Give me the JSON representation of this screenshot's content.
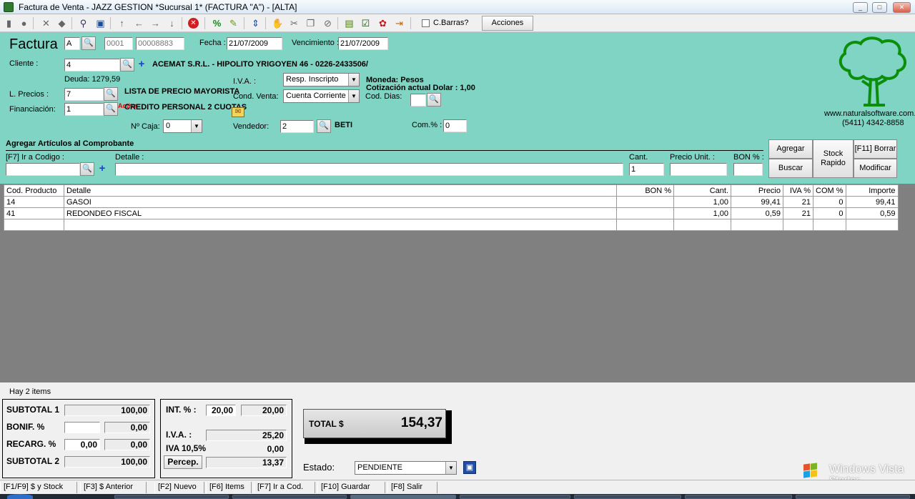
{
  "window": {
    "title": "Factura de Venta - JAZZ GESTION *Sucursal 1* (FACTURA \"A\") - [ALTA]",
    "minimize": "_",
    "maximize": "□",
    "close": "✕"
  },
  "toolbar": {
    "cbarras_label": "C.Barras?",
    "acciones_label": "Acciones"
  },
  "header": {
    "factura_label": "Factura",
    "tipo": "A",
    "punto_venta": "0001",
    "numero": "00008883",
    "fecha_label": "Fecha :",
    "fecha": "21/07/2009",
    "vencimiento_label": "Vencimiento :",
    "vencimiento": "21/07/2009"
  },
  "cliente": {
    "label": "Cliente :",
    "codigo": "4",
    "descripcion": "ACEMAT S.R.L. - HIPOLITO YRIGOYEN 46 - 0226-2433506/",
    "deuda": "Deuda: 1279,59",
    "iva_label": "I.V.A. :",
    "iva_value": "Resp. Inscripto",
    "moneda": "Moneda: Pesos",
    "cotizacion": "Cotización actual Dolar : 1,00",
    "lprecios_label": "L. Precios :",
    "lprecios_codigo": "7",
    "lprecios_desc": "LISTA DE PRECIO MAYORISTA",
    "cond_venta_label": "Cond. Venta:",
    "cond_venta_value": "Cuenta Corriente",
    "cod_dias_label": "Cod. Dias:",
    "cod_dias_value": "",
    "financiacion_label": "Financiación:",
    "financiacion_codigo": "1",
    "financiacion_desc": "CREDITO PERSONAL 2 CUOTAS",
    "red_overlay": "Activa",
    "nro_caja_label": "Nº Caja:",
    "nro_caja_value": "0",
    "vendedor_label": "Vendedor:",
    "vendedor_codigo": "2",
    "vendedor_nombre": "BETI",
    "com_label": "Com.% :",
    "com_value": "0"
  },
  "logo": {
    "website": "www.naturalsoftware.com.ar",
    "phone": "(5411) 4342-8858"
  },
  "agregar": {
    "section_title": "Agregar Artículos al Comprobante",
    "ir_codigo_label": "[F7] Ir a Codigo :",
    "ir_codigo_value": "",
    "detalle_label": "Detalle :",
    "detalle_value": "",
    "cant_label": "Cant.",
    "cant_value": "1",
    "precio_label": "Precio Unit. :",
    "precio_value": "",
    "bon_label": "BON % :",
    "bon_value": "",
    "btn_agregar": "Agregar",
    "btn_buscar": "Buscar",
    "btn_stock": "Stock Rapido",
    "btn_borrar": "[F11] Borrar",
    "btn_modificar": "Modificar"
  },
  "grid": {
    "columns": [
      "Cod. Producto",
      "Detalle",
      "BON %",
      "Cant.",
      "Precio",
      "IVA %",
      "COM %",
      "Importe"
    ],
    "rows": [
      [
        "14",
        "GASOI",
        "",
        "1,00",
        "99,41",
        "21",
        "0",
        "99,41"
      ],
      [
        "41",
        "REDONDEO FISCAL",
        "",
        "1,00",
        "0,59",
        "21",
        "0",
        "0,59"
      ],
      [
        "",
        "",
        "",
        "",
        "",
        "",
        "",
        ""
      ]
    ]
  },
  "totals": {
    "items_count": "Hay 2 items",
    "subtotal1_label": "SUBTOTAL 1",
    "subtotal1": "100,00",
    "bonif_label": "BONIF. %",
    "bonif_pct": "",
    "bonif_value": "0,00",
    "recarg_label": "RECARG. %",
    "recarg_pct": "0,00",
    "recarg_value": "0,00",
    "subtotal2_label": "SUBTOTAL 2",
    "subtotal2": "100,00",
    "int_label": "INT. % :",
    "int_pct": "20,00",
    "int_value": "20,00",
    "iva_label": "I.V.A. :",
    "iva_value": "25,20",
    "iva105_label": "IVA 10,5%",
    "iva105_value": "0,00",
    "percep_label": "Percep.",
    "percep_value": "13,37",
    "total_label": "TOTAL $",
    "total_value": "154,37",
    "estado_label": "Estado:",
    "estado_value": "PENDIENTE"
  },
  "fkeys": [
    "[F1/F9] $ y Stock",
    "[F3] $ Anterior",
    "[F2] Nuevo",
    "[F6] Items",
    "[F7] Ir a Cod.",
    "[F10] Guardar",
    "[F8] Salir"
  ],
  "watermark": {
    "line1": "Windows Vista",
    "line2": "Starter"
  }
}
